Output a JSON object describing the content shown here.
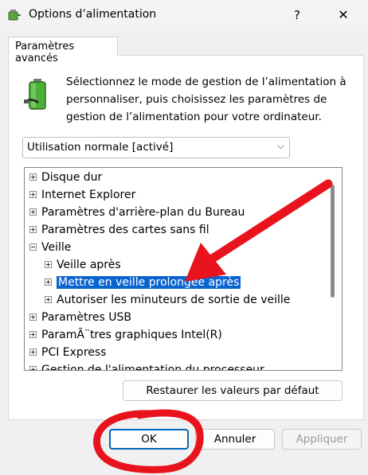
{
  "window": {
    "title": "Options d’alimentation",
    "help_label": "?",
    "close_label": "✕"
  },
  "tab": {
    "label": "Paramètres avancés"
  },
  "description": "Sélectionnez le mode de gestion de l’alimentation à personnaliser, puis choisissez les paramètres de gestion de l’alimentation pour votre ordinateur.",
  "plan_select": {
    "value": "Utilisation normale [activé]"
  },
  "tree": {
    "items": [
      {
        "label": "Disque dur",
        "expander": "+"
      },
      {
        "label": "Internet Explorer",
        "expander": "+"
      },
      {
        "label": "Paramètres d'arrière-plan du Bureau",
        "expander": "+"
      },
      {
        "label": "Paramètres des cartes sans fil",
        "expander": "+"
      },
      {
        "label": "Veille",
        "expander": "-"
      },
      {
        "label": "Veille après",
        "expander": "+"
      },
      {
        "label": "Mettre en veille prolongée après",
        "expander": "+",
        "selected": true
      },
      {
        "label": "Autoriser les minuteurs de sortie de veille",
        "expander": "+"
      },
      {
        "label": "Paramètres USB",
        "expander": "+"
      },
      {
        "label": "ParamÃ¨tres graphiques Intel(R)",
        "expander": "+"
      },
      {
        "label": "PCI Express",
        "expander": "+"
      },
      {
        "label": "Gestion de l'alimentation du processeur",
        "expander": "+"
      }
    ]
  },
  "buttons": {
    "restore": "Restaurer les valeurs par défaut",
    "ok": "OK",
    "cancel": "Annuler",
    "apply": "Appliquer"
  },
  "colors": {
    "selection": "#0a64d0",
    "annotation": "#e8131c",
    "ok_border": "#0067c0"
  },
  "icons": {
    "app": "power-options-icon",
    "battery": "battery-plug-icon"
  }
}
